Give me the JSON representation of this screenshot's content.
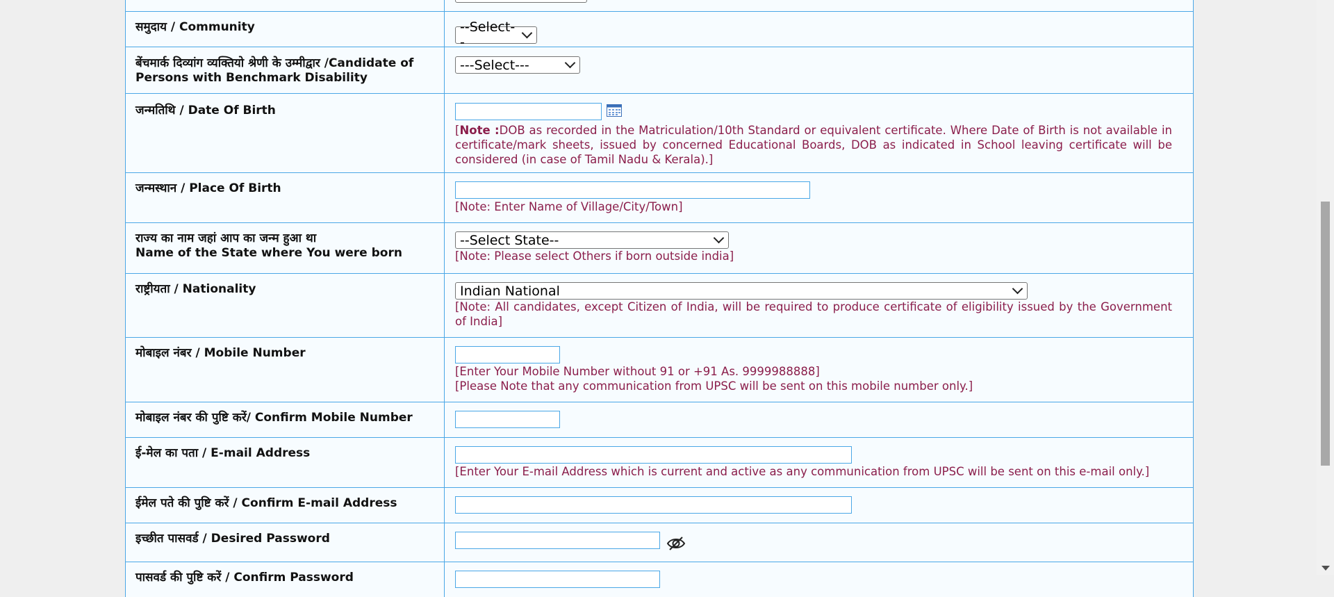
{
  "rows": [
    {
      "label": "समुदाय / Community",
      "select": "--Select--"
    },
    {
      "label": "बेंचमार्क दिव्यांग व्यक्तियो श्रेणी के उम्मीद्वार /Candidate of Persons with Benchmark Disability",
      "select": "---Select---"
    },
    {
      "label": "जन्मतिथि / Date Of Birth",
      "value": "",
      "note_bold": "Note :",
      "note": "DOB as recorded in the Matriculation/10th Standard or equivalent certificate. Where Date of Birth is not available in certificate/mark sheets, issued by concerned Educational Boards, DOB as indicated in School leaving certificate will be considered (in case of Tamil Nadu & Kerala).]"
    },
    {
      "label": "जन्मस्थान / Place Of Birth",
      "value": "",
      "note": "[Note: Enter Name of Village/City/Town]"
    },
    {
      "label_line1": "राज्य का नाम जहां आप का जन्म हुआ था",
      "label_line2": "Name of the State where You were born",
      "select": "--Select State--",
      "note": "[Note: Please select Others if born outside india]"
    },
    {
      "label": "राष्ट्रीयता / Nationality",
      "select": "Indian National",
      "note": "[Note: All candidates, except Citizen of India, will be required to produce certificate of eligibility issued by the Government of India]"
    },
    {
      "label": "मोबाइल नंबर / Mobile Number",
      "value": "",
      "note1": "[Enter Your Mobile Number without 91 or +91 As. 9999988888]",
      "note2": "[Please Note that any communication from UPSC will be sent on this mobile number only.]"
    },
    {
      "label": "मोबाइल नंबर की पुष्टि करें/ Confirm Mobile Number",
      "value": ""
    },
    {
      "label": "ई-मेल का पता / E-mail Address",
      "value": "",
      "note": "[Enter Your E-mail Address which is current and active as any communication from UPSC will be sent on this e-mail only.]"
    },
    {
      "label": "ईमेल पते की पुष्टि करें / Confirm E-mail Address",
      "value": ""
    },
    {
      "label": "इच्छीत पासवर्ड / Desired Password",
      "value": ""
    },
    {
      "label": "पासवर्ड की पुष्टि करें / Confirm Password",
      "value": ""
    }
  ],
  "colors": {
    "border": "#4aa7e6",
    "note": "#8b1e4b",
    "row_bg": "#f7fcff"
  },
  "icons": {
    "date_picker": "calendar-icon",
    "password_toggle": "eye-slash-icon"
  }
}
